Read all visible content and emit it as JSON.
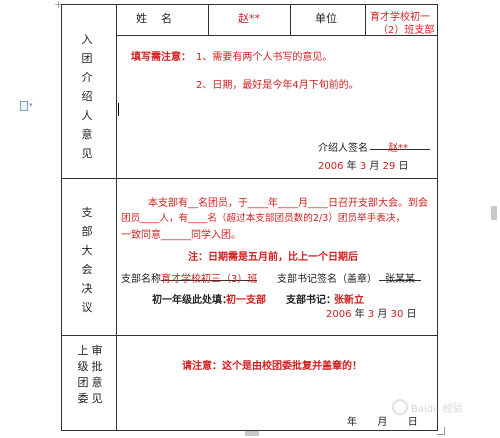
{
  "header": {
    "name_label": "姓    名",
    "name_value": "赵**",
    "unit_label": "单位",
    "unit_value_line1": "育才学校初一",
    "unit_value_line2": "（2）班支部"
  },
  "sections": {
    "introducer": {
      "label_chars": [
        "入",
        "团",
        "介",
        "绍",
        "人",
        "意",
        "见"
      ]
    },
    "branch": {
      "label_chars": [
        "支",
        "部",
        "大",
        "会",
        "决",
        "议"
      ]
    },
    "approval": {
      "label_col1": [
        "上",
        "级",
        "团",
        "委"
      ],
      "label_col2": [
        "审",
        "批",
        "意",
        "见"
      ]
    }
  },
  "introducer": {
    "notice_title": "填写需注意：",
    "notice_1": "1、需要有两个人书写的意见。",
    "notice_2": "2、日期，最好是今年4月下旬前的。",
    "signature_label": "介绍人签名",
    "signature_value": "赵**",
    "date_year": "2006",
    "date_year_suffix": "年",
    "date_month": "3",
    "date_month_suffix": "月",
    "date_day": "29",
    "date_day_suffix": "日"
  },
  "branch": {
    "para_line1": "本支部有__名团员，于____年____月____日召开支部大会。到会",
    "para_line2": "团员____人，有____名（超过本支部团员数的2/3）团员举手表决，",
    "para_line3": "一致同意______同学入团。",
    "note": "注：日期需是五月前，比上一个日期后",
    "branch_name_label": "支部名称",
    "branch_name_value": "育才学校初三（3）班",
    "secretary_label": "支部书记签名（盖章）",
    "secretary_value": "张某某",
    "grade_label": "初一年级此处填：",
    "grade_value": "初一支部",
    "sec2_label": "支部书记：",
    "sec2_value": "张新立",
    "date_year": "2006",
    "date_year_suffix": "年",
    "date_month": "3",
    "date_month_suffix": "月",
    "date_day": "30",
    "date_day_suffix": "日"
  },
  "approval": {
    "notice": "请注意：这个是由校团委批复并盖章的！",
    "date_year_suffix": "年",
    "date_month_suffix": "月",
    "date_day_suffix": "日"
  },
  "chrome": {
    "corner_mark": "+",
    "watermark_text": "Baidu 经验"
  }
}
